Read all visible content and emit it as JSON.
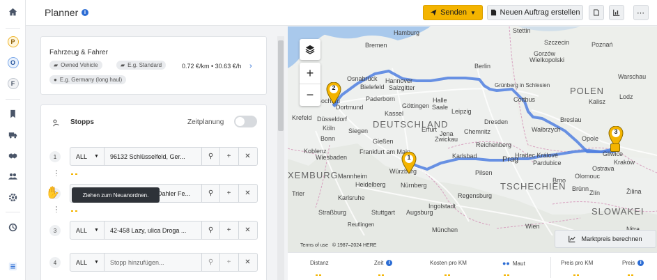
{
  "app": {
    "title": "Planner"
  },
  "toolbar": {
    "send_label": "Senden",
    "new_order_label": "Neuen Auftrag erstellen"
  },
  "rail": {
    "badges": [
      "P",
      "O",
      "F"
    ]
  },
  "vehicle": {
    "heading": "Fahrzeug & Fahrer",
    "chips": [
      "Owned Vehicle",
      "E.g. Standard",
      "E.g. Germany (long haul)"
    ],
    "price": "0.72 €/km • 30.63 €/h"
  },
  "stops": {
    "heading": "Stopps",
    "schedule_label": "Zeitplanung",
    "items": [
      {
        "num": "1",
        "type": "ALL",
        "address": "96132 Schlüsselfeld, Ger..."
      },
      {
        "num": "2",
        "type": "ALL",
        "address": "Dahler Fe..."
      },
      {
        "num": "3",
        "type": "ALL",
        "address": "42-458 Lazy, ulica Droga ..."
      },
      {
        "num": "4",
        "type": "ALL",
        "address": "",
        "placeholder": "Stopp hinzufügen..."
      }
    ],
    "tooltip": "Ziehen zum Neuanordnen."
  },
  "map": {
    "country_labels": [
      "DEUTSCHLAND",
      "POLEN",
      "TSCHECHIEN",
      "SLOWAKEI",
      "XEMBURG"
    ],
    "city_labels": [
      "Stettin",
      "Hamburg",
      "Bremen",
      "Szczecin",
      "Gorzów",
      "Poznań",
      "Wielkopolski",
      "Berlin",
      "Osnabrück",
      "Bielefeld",
      "Salzgitter",
      "Hannover",
      "Warschau",
      "Dortmund",
      "Paderborn",
      "Kassel",
      "Halle",
      "Saale",
      "Grünberg in Schlesien",
      "Cottbus",
      "Lodz",
      "Kalisz",
      "Krefeld",
      "Düsseldorf",
      "Köln",
      "Bonn",
      "Siegen",
      "Gießen",
      "Göttingen",
      "Erfurt",
      "Leipzig",
      "Dresden",
      "Chemnitz",
      "Zwickau",
      "Breslau",
      "Wałbrzych",
      "Hradec Králové",
      "Pardubice",
      "Opole",
      "Ostrava",
      "Kraków",
      "Wiesbaden",
      "Frankfurt am Main",
      "Würzburg",
      "Nürnberg",
      "Reichenberg",
      "Karlsbad",
      "Pilsen",
      "Prag",
      "Brünn",
      "Koblenz",
      "Mannheim",
      "Heidelberg",
      "Karlsruhe",
      "Straßburg",
      "Stuttgart",
      "Reutlingen",
      "Augsburg",
      "München",
      "Wien",
      "Ingolstadt",
      "Regensburg",
      "Zlín",
      "Žilina",
      "Nitra",
      "Trier",
      "Brno",
      "Olomouc",
      "Gliwice",
      "Jena",
      "Bochum"
    ],
    "markers": [
      {
        "num": "1"
      },
      {
        "num": "2"
      },
      {
        "num": "3"
      }
    ],
    "attribution_terms": "Terms of use",
    "attribution_copy": "© 1987–2024 HERE",
    "market_price_button": "Marktpreis berechnen",
    "route_color": "#4f7fe0",
    "marker_color": "#f4b400"
  },
  "footer": {
    "metrics": [
      "Distanz",
      "Zeit",
      "Kosten pro KM",
      "Maut",
      "Preis pro KM",
      "Preis"
    ]
  },
  "colors": {
    "accent": "#f4b400",
    "info_blue": "#2b6cd4"
  }
}
